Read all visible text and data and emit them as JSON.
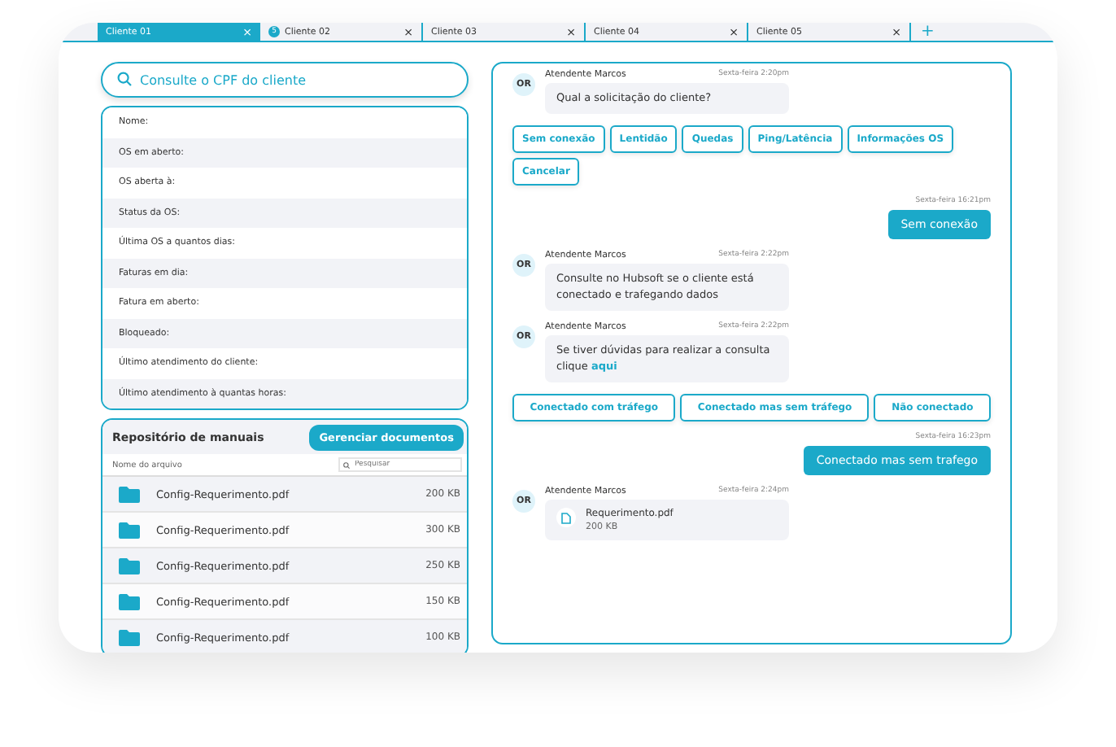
{
  "tabs": [
    {
      "label": "Cliente 01",
      "selected": true
    },
    {
      "label": "Cliente 02",
      "selected": false,
      "badge": "5"
    },
    {
      "label": "Cliente 03",
      "selected": false
    },
    {
      "label": "Cliente 04",
      "selected": false
    },
    {
      "label": "Cliente 05",
      "selected": false
    }
  ],
  "tab_close": "×",
  "tab_add": "+",
  "search": {
    "placeholder": "Consulte o CPF do cliente"
  },
  "client_fields": [
    "Nome:",
    "OS em aberto:",
    "OS aberta à:",
    "Status da OS:",
    "Última OS a quantos dias:",
    "Faturas em dia:",
    "Fatura em aberto:",
    "Bloqueado:",
    "Último atendimento do cliente:",
    "Último atendimento à quantas horas:"
  ],
  "manuals": {
    "title": "Repositório de manuais",
    "button": "Gerenciar documentos",
    "column": "Nome do arquivo",
    "search_placeholder": "Pesquisar",
    "files": [
      {
        "name": "Config-Requerimento.pdf",
        "size": "200 KB"
      },
      {
        "name": "Config-Requerimento.pdf",
        "size": "300 KB"
      },
      {
        "name": "Config-Requerimento.pdf",
        "size": "250 KB"
      },
      {
        "name": "Config-Requerimento.pdf",
        "size": "150 KB"
      },
      {
        "name": "Config-Requerimento.pdf",
        "size": "100 KB"
      }
    ]
  },
  "chat": [
    {
      "kind": "agent",
      "avatar": "OR",
      "author": "Atendente Marcos",
      "time": "Sexta-feira 2:20pm",
      "text": "Qual a solicitação do cliente?"
    },
    {
      "kind": "options",
      "options": [
        "Sem conexão",
        "Lentidão",
        "Quedas",
        "Ping/Latência",
        "Informações OS",
        "Cancelar"
      ]
    },
    {
      "kind": "user",
      "time": "Sexta-feira 16:21pm",
      "text": "Sem conexão"
    },
    {
      "kind": "agent",
      "avatar": "OR",
      "author": "Atendente Marcos",
      "time": "Sexta-feira 2:22pm",
      "text": "Consulte no Hubsoft se o cliente está conectado e trafegando dados"
    },
    {
      "kind": "agent",
      "avatar": "OR",
      "author": "Atendente Marcos",
      "time": "Sexta-feira 2:22pm",
      "text": "Se tiver dúvidas para realizar a consulta clique",
      "link": "aqui"
    },
    {
      "kind": "options",
      "options": [
        "Conectado com tráfego",
        "Conectado mas sem tráfego",
        "Não conectado"
      ]
    },
    {
      "kind": "user",
      "time": "Sexta-feira 16:23pm",
      "text": "Conectado mas sem trafego"
    },
    {
      "kind": "agent",
      "avatar": "OR",
      "author": "Atendente Marcos",
      "time": "Sexta-feira 2:24pm",
      "file": {
        "name": "Requerimento.pdf",
        "size": "200 KB"
      }
    }
  ]
}
